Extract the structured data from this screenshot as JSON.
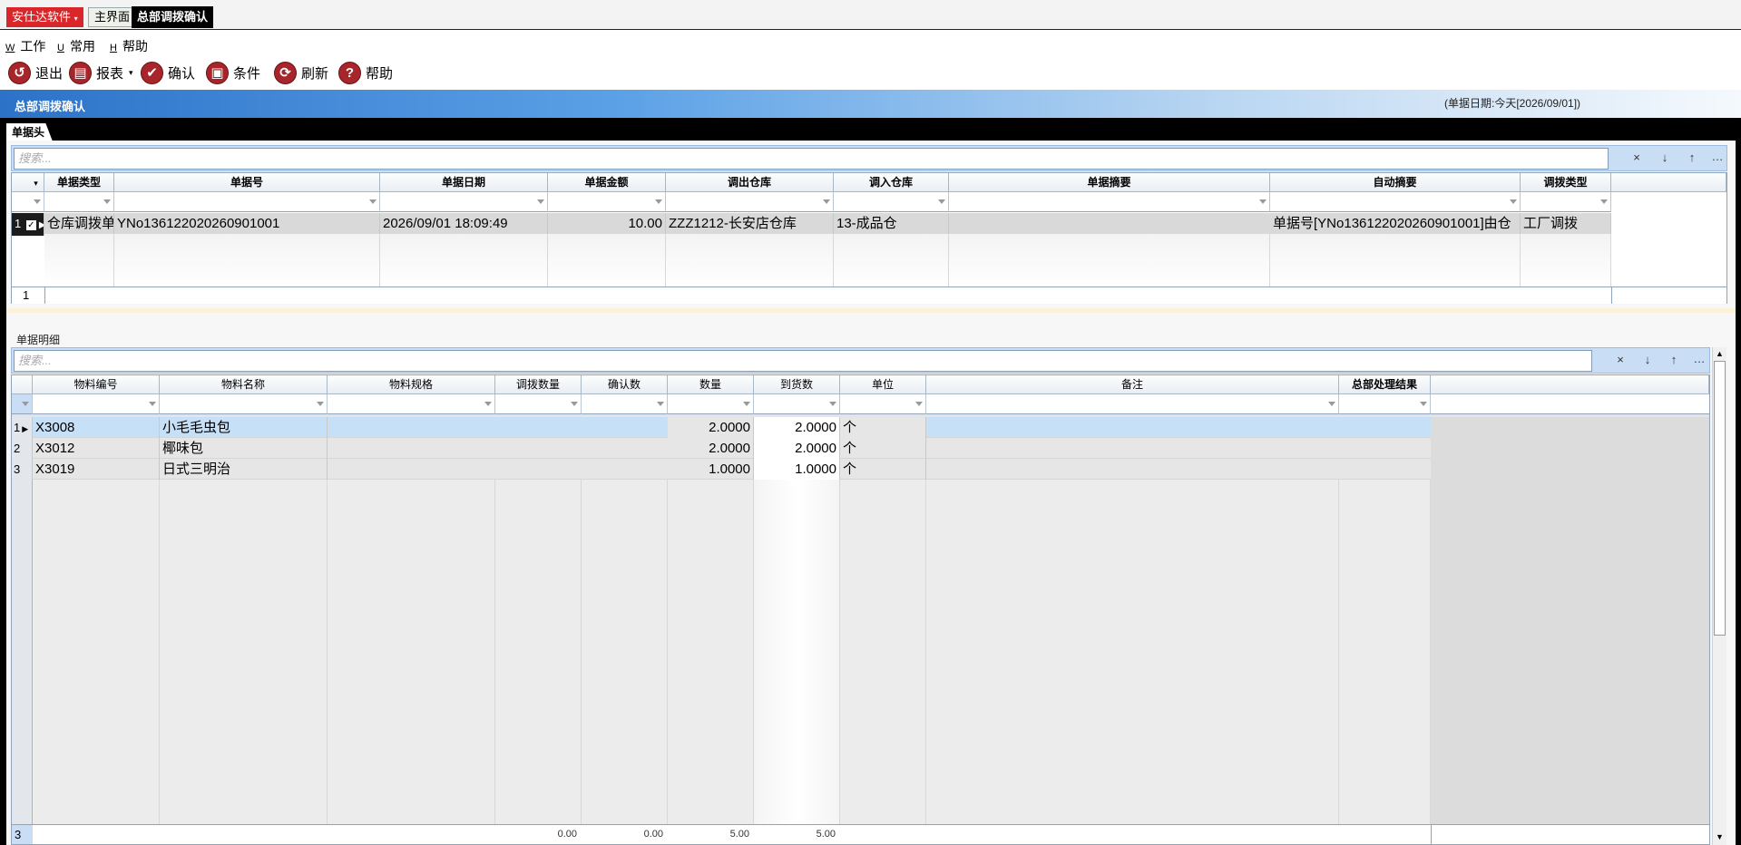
{
  "brand": "安仕达软件",
  "tabs": [
    "主界面",
    "总部调拨确认"
  ],
  "menu": [
    {
      "key": "W",
      "label": "工作"
    },
    {
      "key": "U",
      "label": "常用"
    },
    {
      "key": "H",
      "label": "帮助"
    }
  ],
  "toolbar": [
    {
      "label": "退出",
      "icon": "exit-icon"
    },
    {
      "label": "报表",
      "icon": "print-icon"
    },
    {
      "label": "确认",
      "icon": "check-icon"
    },
    {
      "label": "条件",
      "icon": "filter-icon"
    },
    {
      "label": "刷新",
      "icon": "refresh-icon"
    },
    {
      "label": "帮助",
      "icon": "help-icon"
    }
  ],
  "page_title": "总部调拨确认",
  "date_info": "(单据日期:今天[2026/09/01])",
  "header_section": {
    "tab": "单据头",
    "search_placeholder": "搜索...",
    "columns": [
      "单据类型",
      "单据号",
      "单据日期",
      "单据金额",
      "调出仓库",
      "调入仓库",
      "单据摘要",
      "自动摘要",
      "调拨类型"
    ],
    "rows": [
      {
        "index": "1",
        "type": "仓库调拨单",
        "no": "YNo136122020260901001",
        "date": "2026/09/01 18:09:49",
        "amount": "10.00",
        "out_wh": "ZZZ1212-长安店仓库",
        "in_wh": "13-成品仓",
        "memo": "",
        "auto_memo": "单据号[YNo136122020260901001]由仓",
        "transfer_type": "工厂调拨"
      }
    ],
    "footer_count": "1"
  },
  "detail_section": {
    "label": "单据明细",
    "search_placeholder": "搜索...",
    "columns": [
      "物料编号",
      "物料名称",
      "物料规格",
      "调拨数量",
      "确认数",
      "数量",
      "到货数",
      "单位",
      "备注",
      "总部处理结果"
    ],
    "rows": [
      {
        "index": "1",
        "code": "X3008",
        "name": "小毛毛虫包",
        "spec": "",
        "transfer_qty": "",
        "confirm_qty": "",
        "qty": "2.0000",
        "arrived": "2.0000",
        "unit": "个",
        "remark": "",
        "result": ""
      },
      {
        "index": "2",
        "code": "X3012",
        "name": "椰味包",
        "spec": "",
        "transfer_qty": "",
        "confirm_qty": "",
        "qty": "2.0000",
        "arrived": "2.0000",
        "unit": "个",
        "remark": "",
        "result": ""
      },
      {
        "index": "3",
        "code": "X3019",
        "name": "日式三明治",
        "spec": "",
        "transfer_qty": "",
        "confirm_qty": "",
        "qty": "1.0000",
        "arrived": "1.0000",
        "unit": "个",
        "remark": "",
        "result": ""
      }
    ],
    "footer": {
      "count": "3",
      "transfer_qty": "0.00",
      "confirm_qty": "0.00",
      "qty": "5.00",
      "arrived": "5.00"
    }
  },
  "search_buttons": [
    "×",
    "↓",
    "↑",
    "…"
  ],
  "colors": {
    "brand_red": "#d9262a",
    "icon_red": "#a7262b",
    "title_blue": "#2c72c8",
    "selected_row": "#c5e0f7"
  }
}
